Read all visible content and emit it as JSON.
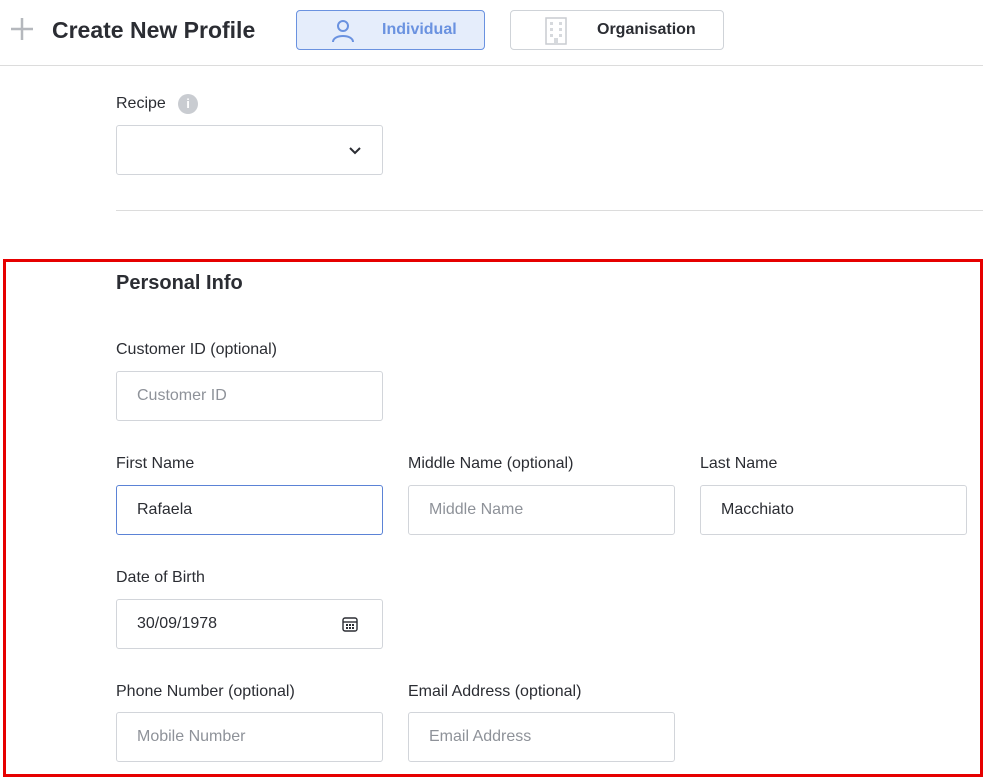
{
  "header": {
    "title": "Create New Profile",
    "profile_types": [
      {
        "label": "Individual",
        "icon": "person-icon",
        "selected": true
      },
      {
        "label": "Organisation",
        "icon": "building-icon",
        "selected": false
      }
    ]
  },
  "recipe": {
    "label": "Recipe",
    "value": ""
  },
  "personal_info": {
    "title": "Personal Info",
    "customer_id": {
      "label": "Customer ID (optional)",
      "placeholder": "Customer ID",
      "value": ""
    },
    "first_name": {
      "label": "First Name",
      "placeholder": "",
      "value": "Rafaela"
    },
    "middle_name": {
      "label": "Middle Name (optional)",
      "placeholder": "Middle Name",
      "value": ""
    },
    "last_name": {
      "label": "Last Name",
      "placeholder": "",
      "value": "Macchiato"
    },
    "date_of_birth": {
      "label": "Date of Birth",
      "value": "30/09/1978"
    },
    "phone": {
      "label": "Phone Number (optional)",
      "placeholder": "Mobile Number",
      "value": ""
    },
    "email": {
      "label": "Email Address (optional)",
      "placeholder": "Email Address",
      "value": ""
    }
  },
  "colors": {
    "accent": "#6a92e0",
    "accent_bg": "#e5edfb",
    "highlight_border": "#e60000"
  }
}
